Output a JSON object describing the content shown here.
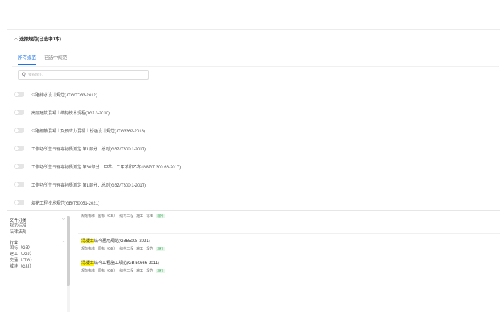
{
  "panel": {
    "title": "选择规范(已选中0本)",
    "tabs": [
      {
        "label": "所有规范"
      },
      {
        "label": "已选中规范"
      }
    ],
    "search_placeholder": "搜索规范",
    "standards": [
      {
        "label": "公路排水设计规范(JTG/TD33-2012)",
        "enabled": false
      },
      {
        "label": "高层建筑混凝土结构技术规程(JGJ 3-2010)",
        "enabled": false
      },
      {
        "label": "公路钢筋混凝土及预应力混凝土桥涵设计规范(JTG3362-2018)",
        "enabled": false
      },
      {
        "label": "工作场所空气有毒物质测定 第1部分：总则(GBZ/T300.1-2017)",
        "enabled": false
      },
      {
        "label": "工作场所空气有毒物质测定 第60部分：甲苯、二甲苯和乙苯(GBZ/T 300.66-2017)",
        "enabled": false
      },
      {
        "label": "工作场所空气有毒物质测定 第1部分：总则(GBZ/T300.1-2017)",
        "enabled": false
      },
      {
        "label": "烟花工程技术规范(GB/T50051-2021)",
        "enabled": false
      }
    ]
  },
  "sidebar": {
    "groups": [
      {
        "label": "文件分类",
        "items": [
          "规范标准",
          "法律法规"
        ]
      },
      {
        "label": "行业",
        "items": [
          "国标（GB）",
          "建工（JGJ）",
          "交通（JTG）",
          "城建（CJJ）"
        ]
      }
    ]
  },
  "results": [
    {
      "title_hl": "",
      "title_rest": "",
      "tags": [
        "规范标准",
        "国标（GB）",
        "结构工程",
        "施工",
        "标准"
      ],
      "badge": "现行"
    },
    {
      "title_hl": "混凝土",
      "title_rest": "结构通用规范(GB55008-2021)",
      "tags": [
        "规范标准",
        "国标（GB）",
        "结构工程",
        "施工",
        "规范"
      ],
      "badge": "现行"
    },
    {
      "title_hl": "混凝土",
      "title_rest": "结构工程施工规范(GB 50666-2011)",
      "tags": [
        "规范标准",
        "国标（GB）",
        "结构工程",
        "施工",
        "规范"
      ],
      "badge": "现行"
    },
    {
      "title_hl": "",
      "title_rest": "",
      "tags": [],
      "badge": ""
    }
  ],
  "colors": {
    "accent": "#1a73e8",
    "highlight": "#fff200",
    "badge_bg": "#e6f6ea",
    "badge_text": "#35a552"
  },
  "icons": {
    "collapse": "chevron-up-icon",
    "search": "search-icon",
    "expand": "chevron-down-icon"
  }
}
